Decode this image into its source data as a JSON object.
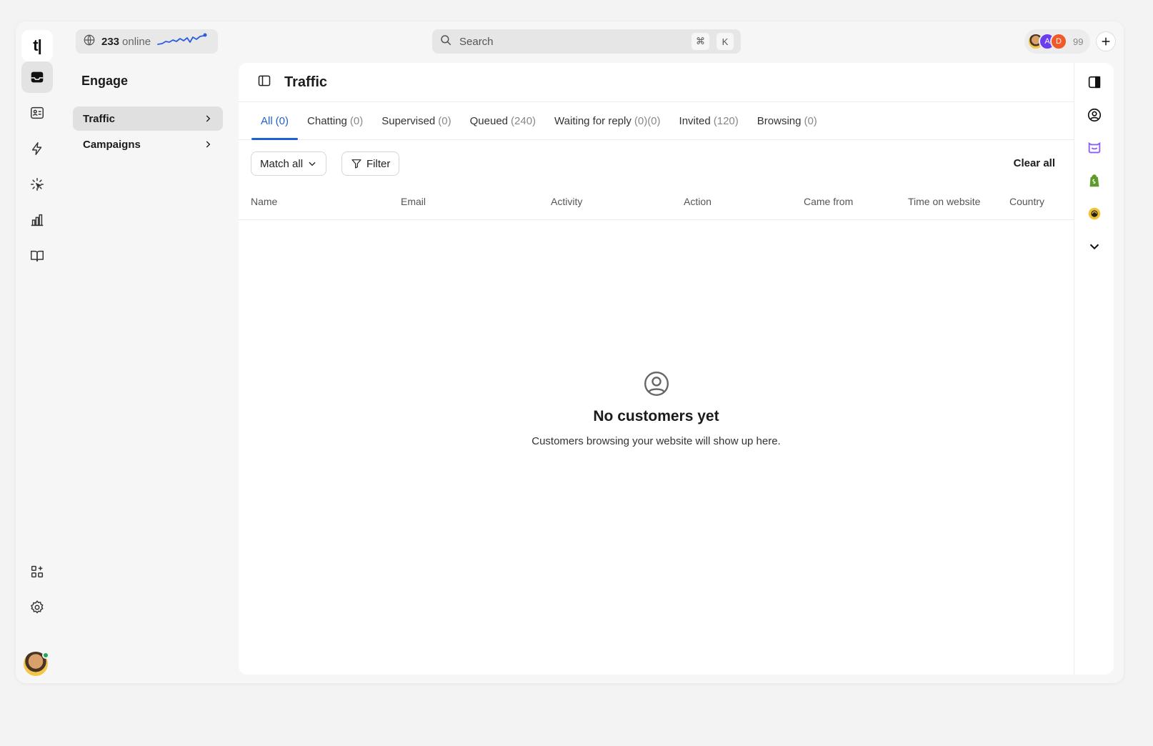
{
  "top": {
    "online_count": "233",
    "online_label": "online",
    "search_placeholder": "Search",
    "shortcut_key1": "⌘",
    "shortcut_key2": "K",
    "team_avatar2": "A",
    "team_avatar3": "D",
    "team_count": "99"
  },
  "rail": {
    "logo": "t|",
    "items": [
      "inbox-icon",
      "contacts-icon",
      "automation-icon",
      "engage-icon",
      "reports-icon",
      "knowledge-icon"
    ],
    "bottom": [
      "apps-icon",
      "settings-icon"
    ]
  },
  "engage": {
    "title": "Engage",
    "nav": [
      {
        "label": "Traffic",
        "active": true
      },
      {
        "label": "Campaigns",
        "active": false
      }
    ]
  },
  "main": {
    "title": "Traffic",
    "tabs": [
      {
        "label": "All",
        "count": "(0)",
        "active": true
      },
      {
        "label": "Chatting",
        "count": "(0)"
      },
      {
        "label": "Supervised",
        "count": "(0)"
      },
      {
        "label": "Queued",
        "count": "(240)"
      },
      {
        "label": "Waiting for reply",
        "count": "(0)(0)"
      },
      {
        "label": "Invited",
        "count": "(120)"
      },
      {
        "label": "Browsing",
        "count": "(0)"
      }
    ],
    "match_all": "Match all",
    "filter": "Filter",
    "clear_all": "Clear all",
    "columns": [
      "Name",
      "Email",
      "Activity",
      "Action",
      "Came from",
      "Time on website",
      "Country"
    ],
    "empty_title": "No customers yet",
    "empty_sub": "Customers browsing your website will show up here."
  },
  "colors": {
    "accent": "#1f5fd6",
    "sparkline": "#2d5be3",
    "online_status": "#1faa4d",
    "messenger": "#8b5cf6",
    "shopify": "#5e9b2a"
  }
}
